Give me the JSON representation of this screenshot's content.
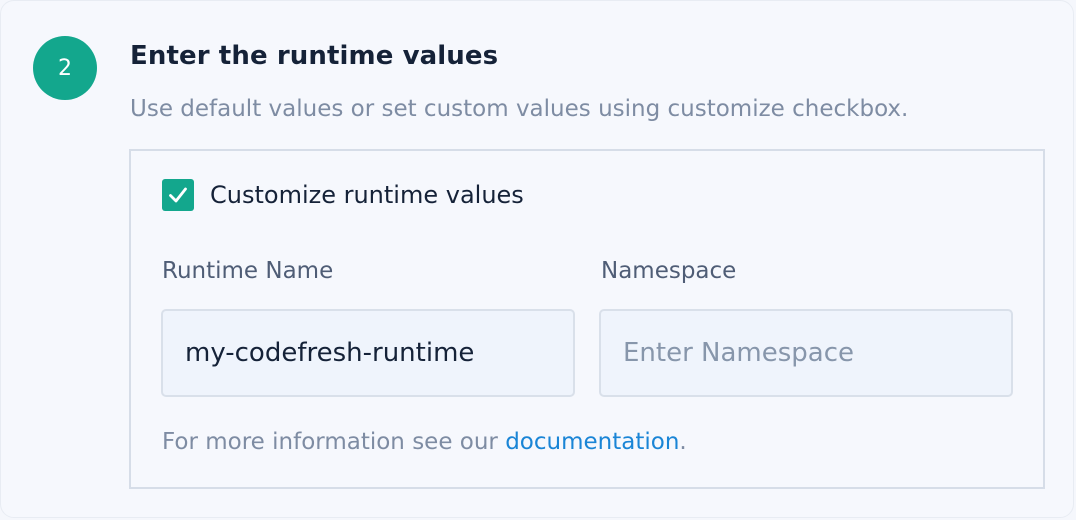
{
  "step": {
    "number": "2",
    "title": "Enter the runtime values",
    "subtitle": "Use default values or set custom values using customize checkbox."
  },
  "customize": {
    "label": "Customize runtime values",
    "checked": true
  },
  "fields": {
    "runtime_name": {
      "label": "Runtime Name",
      "value": "my-codefresh-runtime"
    },
    "namespace": {
      "label": "Namespace",
      "value": "",
      "placeholder": "Enter Namespace"
    }
  },
  "help": {
    "prefix": "For more information see our ",
    "link_text": "documentation",
    "suffix": "."
  },
  "colors": {
    "accent": "#13a78d",
    "link": "#1a85d6",
    "text_primary": "#152238",
    "text_muted": "#7e8ca3"
  },
  "icons": {
    "checkbox": "check-icon"
  }
}
